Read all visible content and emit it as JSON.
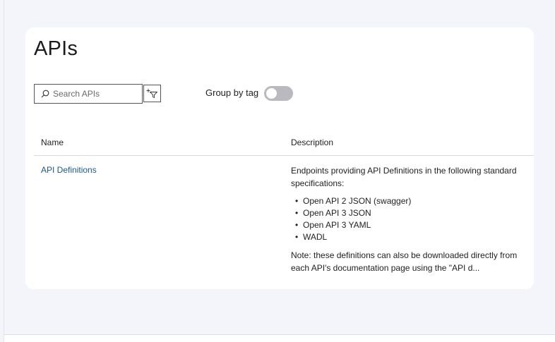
{
  "page": {
    "title": "APIs"
  },
  "toolbar": {
    "search_placeholder": "Search APIs",
    "group_by_tag_label": "Group by tag",
    "group_by_tag_on": false
  },
  "table": {
    "columns": [
      "Name",
      "Description"
    ],
    "rows": [
      {
        "name": "API Definitions",
        "description_intro": "Endpoints providing API Definitions in the following standard specifications:",
        "bullets": [
          "Open API 2 JSON (swagger)",
          "Open API 3 JSON",
          "Open API 3 YAML",
          "WADL"
        ],
        "description_note": "Note: these definitions can also be downloaded directly from each API's documentation page using the \"API d..."
      }
    ]
  },
  "icons": {
    "search": "search-icon",
    "filter": "add-filter-icon"
  },
  "colors": {
    "link": "#1a5a86",
    "toggle_off": "#b9b9bf",
    "background": "#f4f5fb"
  }
}
